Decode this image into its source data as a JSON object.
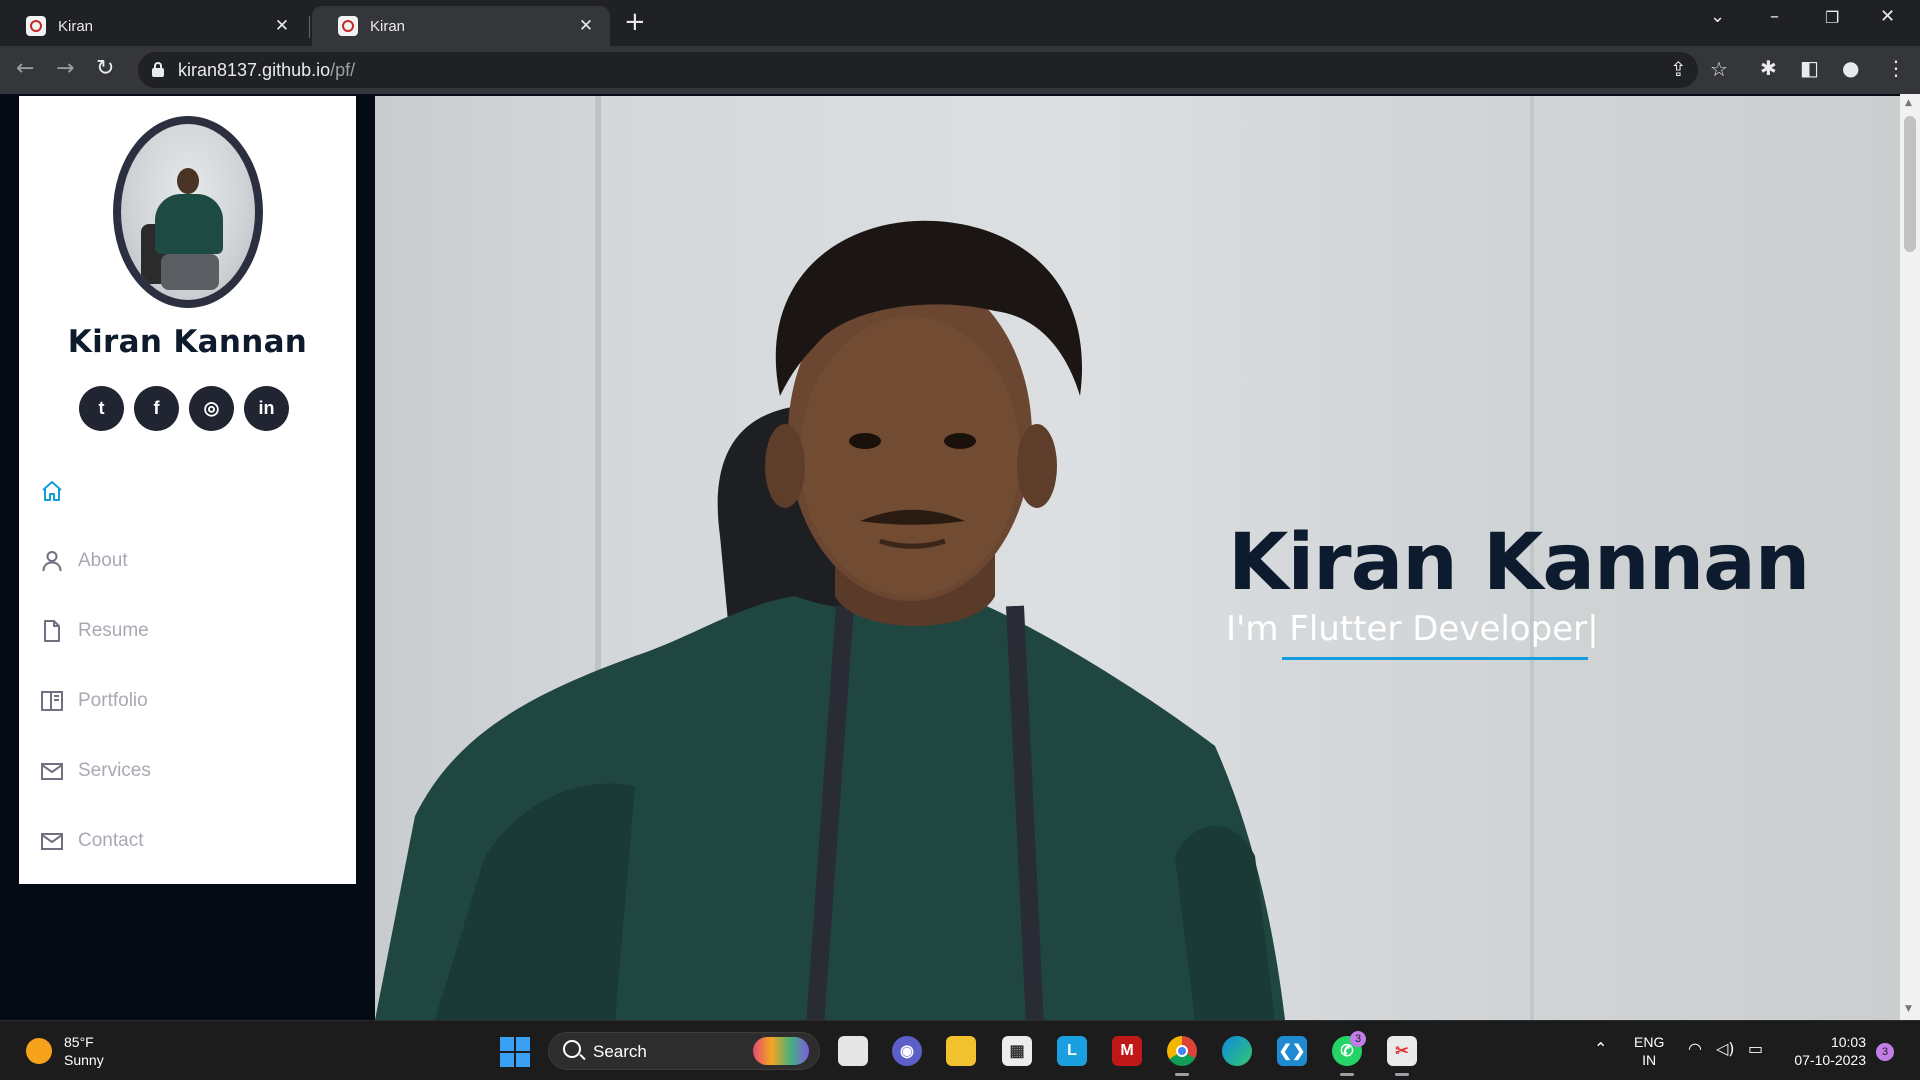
{
  "browser": {
    "tabs": [
      {
        "title": "Kiran",
        "active": false
      },
      {
        "title": "Kiran",
        "active": true
      }
    ],
    "new_tab_icon": "plus-icon",
    "url_host": "kiran8137.github.io",
    "url_path": "/pf/"
  },
  "sidebar": {
    "name": "Kiran Kannan",
    "socials": [
      {
        "icon": "twitter-icon",
        "glyph": "t"
      },
      {
        "icon": "facebook-icon",
        "glyph": "f"
      },
      {
        "icon": "instagram-icon",
        "glyph": "◎"
      },
      {
        "icon": "linkedin-icon",
        "glyph": "in"
      }
    ],
    "nav": [
      {
        "icon": "home-icon",
        "label": "",
        "active": true
      },
      {
        "icon": "person-icon",
        "label": "About"
      },
      {
        "icon": "file-icon",
        "label": "Resume"
      },
      {
        "icon": "book-icon",
        "label": "Portfolio"
      },
      {
        "icon": "envelope-icon",
        "label": "Services"
      },
      {
        "icon": "envelope-icon",
        "label": "Contact"
      }
    ],
    "accent": "#149ddd"
  },
  "hero": {
    "title": "Kiran Kannan",
    "subtitle": "I'm Flutter Developer",
    "cursor": "|"
  },
  "taskbar": {
    "weather_temp": "85°F",
    "weather_desc": "Sunny",
    "search_label": "Search",
    "whatsapp_badge": "3",
    "language_line1": "ENG",
    "language_line2": "IN",
    "time": "10:03",
    "date": "07-10-2023",
    "notification_count": "3"
  }
}
